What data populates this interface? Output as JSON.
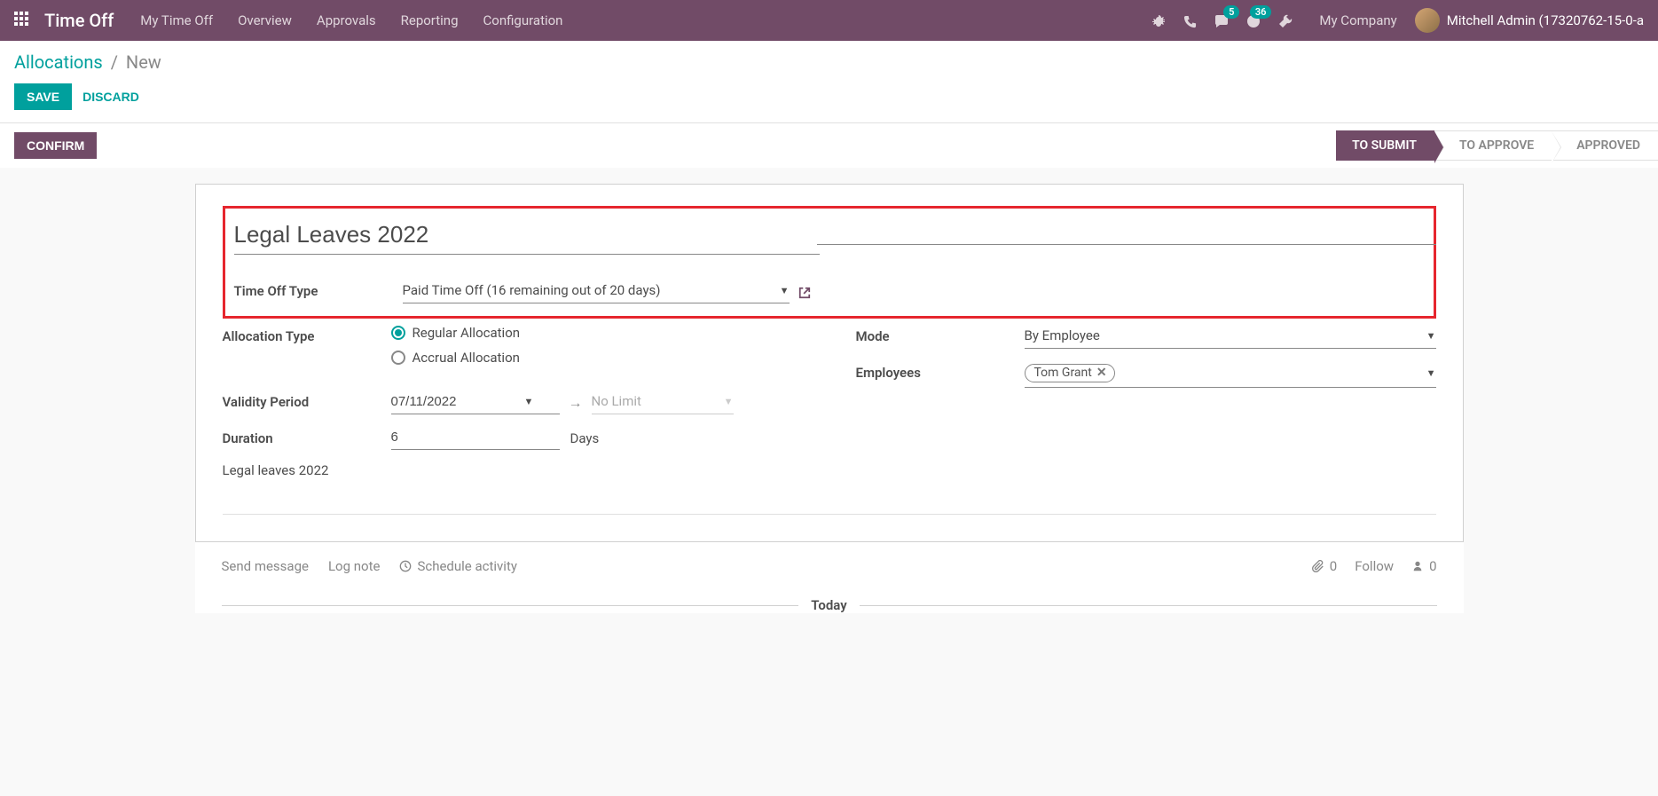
{
  "navbar": {
    "brand": "Time Off",
    "links": [
      "My Time Off",
      "Overview",
      "Approvals",
      "Reporting",
      "Configuration"
    ],
    "chat_badge": "5",
    "activity_badge": "36",
    "company": "My Company",
    "user": "Mitchell Admin (17320762-15-0-a"
  },
  "breadcrumb": {
    "parent": "Allocations",
    "current": "New"
  },
  "buttons": {
    "save": "Save",
    "discard": "Discard",
    "confirm": "Confirm"
  },
  "status": {
    "steps": [
      "To Submit",
      "To Approve",
      "Approved"
    ],
    "active_index": 0
  },
  "form": {
    "title": "Legal Leaves 2022",
    "labels": {
      "time_off_type": "Time Off Type",
      "allocation_type": "Allocation Type",
      "validity_period": "Validity Period",
      "duration": "Duration",
      "mode": "Mode",
      "employees": "Employees"
    },
    "time_off_type": "Paid Time Off (16 remaining out of 20 days)",
    "allocation_regular": "Regular Allocation",
    "allocation_accrual": "Accrual Allocation",
    "validity_start": "07/11/2022",
    "validity_end_placeholder": "No Limit",
    "duration_value": "6",
    "duration_unit": "Days",
    "note": "Legal leaves 2022",
    "mode": "By Employee",
    "employee_tag": "Tom Grant"
  },
  "chatter": {
    "send_message": "Send message",
    "log_note": "Log note",
    "schedule_activity": "Schedule activity",
    "attach_count": "0",
    "follow": "Follow",
    "follower_count": "0",
    "today": "Today"
  }
}
